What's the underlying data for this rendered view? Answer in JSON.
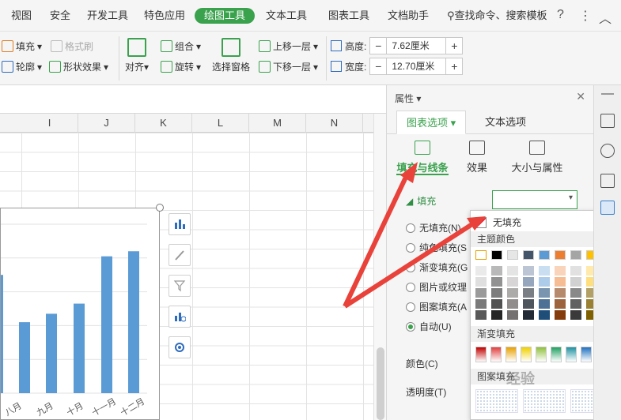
{
  "menubar": {
    "tabs": [
      "视图",
      "安全",
      "开发工具",
      "特色应用",
      "绘图工具",
      "文本工具",
      "图表工具",
      "文档助手"
    ],
    "active_tab": "绘图工具",
    "search_label": "查找命令、搜索模板",
    "help": "?",
    "more": "⋮",
    "collapse": "︿"
  },
  "ribbon": {
    "fill": "填充",
    "format_brush": "格式刷",
    "outline": "轮廓",
    "shape_effect": "形状效果",
    "align": "对齐",
    "group": "组合",
    "rotate": "旋转",
    "selection_pane": "选择窗格",
    "bring_forward": "上移一层",
    "send_backward": "下移一层",
    "height_label": "高度:",
    "height_value": "7.62厘米",
    "width_label": "宽度:",
    "width_value": "12.70厘米"
  },
  "sheet": {
    "columns": [
      "I",
      "J",
      "K",
      "L",
      "M",
      "N"
    ]
  },
  "chart_data": {
    "type": "bar",
    "categories": [
      "八月",
      "九月",
      "十月",
      "十一月",
      "十二月"
    ],
    "x_tick_labels_visible": [
      "八月",
      "九月",
      "十月",
      "十一月",
      "十二月"
    ],
    "values": [
      null,
      42,
      47,
      53,
      81,
      84
    ],
    "partial_first_bar": 70,
    "ylim": [
      0,
      100
    ],
    "grid": true,
    "color": "#5b9bd5"
  },
  "panel": {
    "title": "属性",
    "tab_chart": "图表选项",
    "tab_text": "文本选项",
    "sub_fill_line": "填充与线条",
    "sub_effect": "效果",
    "sub_size": "大小与属性",
    "section_fill": "填充",
    "options": [
      "无填充(N)",
      "纯色填充(S",
      "渐变填充(G",
      "图片或纹理",
      "图案填充(A",
      "自动(U)"
    ],
    "color_label": "颜色(C)",
    "transparency_label": "透明度(T)"
  },
  "popup": {
    "no_fill": "无填充",
    "theme_colors": "主题颜色",
    "gradient_fill": "渐变填充",
    "pattern_fill": "图案填充",
    "theme_top": [
      "#ffffff",
      "#000000",
      "#e7e6e6",
      "#44546a",
      "#5b9bd5",
      "#ed7d31",
      "#a5a5a5",
      "#ffc000",
      "#4472c4",
      "#70ad47"
    ],
    "gradient": [
      "#c00000",
      "#e04040",
      "#e8a000",
      "#f0d000",
      "#90c040",
      "#20a060",
      "#2090a0",
      "#2070c0",
      "#7030a0"
    ]
  },
  "watermark": "经验"
}
